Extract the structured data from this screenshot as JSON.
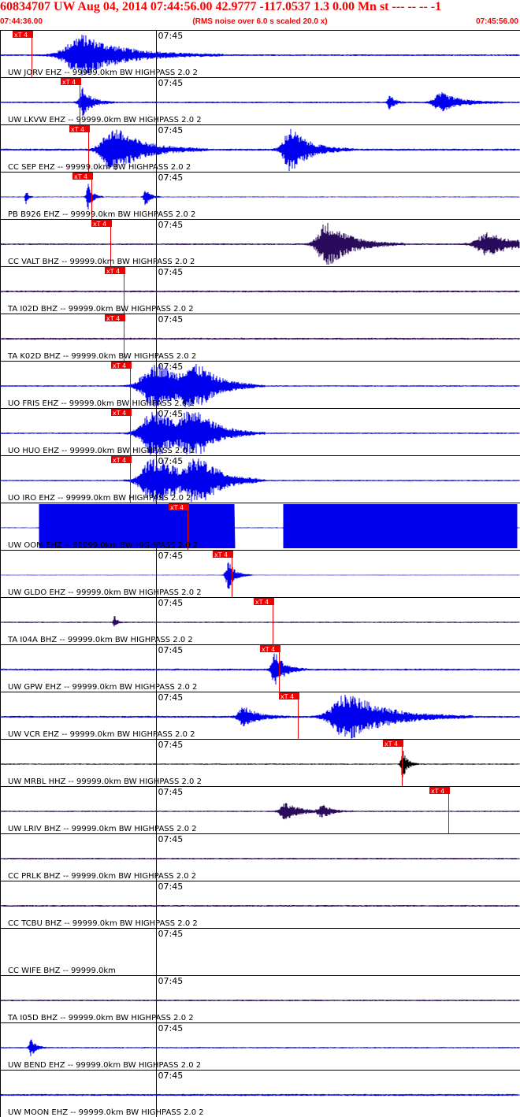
{
  "header": {
    "title": "60834707 UW Aug 04, 2014 07:44:56.00   42.9777 -117.0537  1.3 0.00 Mn st --- -- --  -1",
    "start_time": "07:44:36.00",
    "scale_note": "(RMS noise over 6.0 s scaled 20.0 x)",
    "end_time": "07:45:56.00"
  },
  "colors": {
    "ehz": "#0000ee",
    "bhz": "#2a0a5a",
    "hhz": "#000000",
    "pick": "#ee0000",
    "label": "#000000"
  },
  "chart_data": {
    "type": "seismogram",
    "time_range": [
      "07:44:36.00",
      "07:45:56.00"
    ],
    "minute_mark": "07:45",
    "pick_label": "xT 4",
    "traces": [
      {
        "label": "UW JORV EHZ -- 99999.0km BW  HIGHPASS  2.0  2",
        "color": "ehz",
        "pick": 0.061,
        "events": [
          {
            "c": 0.16,
            "w": 0.09,
            "a": 2.6
          }
        ],
        "noise": 0.35
      },
      {
        "label": "UW LKVW EHZ -- 99999.0km BW  HIGHPASS  2.0  2",
        "color": "ehz",
        "pick": 0.153,
        "events": [
          {
            "c": 0.16,
            "w": 0.02,
            "a": 1.8
          },
          {
            "c": 0.85,
            "w": 0.04,
            "a": 1.2
          },
          {
            "c": 0.75,
            "w": 0.01,
            "a": 1.0
          }
        ],
        "noise": 0.35
      },
      {
        "label": "CC SEP EHZ -- 99999.0km BW  HIGHPASS  2.0  2",
        "color": "ehz",
        "pick": 0.17,
        "events": [
          {
            "c": 0.22,
            "w": 0.06,
            "a": 3.0
          },
          {
            "c": 0.56,
            "w": 0.04,
            "a": 2.8
          }
        ],
        "noise": 0.45
      },
      {
        "label": "PB B926 EHZ -- 99999.0km BW  HIGHPASS  2.0  2",
        "color": "ehz",
        "pick": 0.176,
        "events": [
          {
            "c": 0.17,
            "w": 0.01,
            "a": 1.6
          },
          {
            "c": 0.28,
            "w": 0.01,
            "a": 1.2
          },
          {
            "c": 0.05,
            "w": 0.005,
            "a": 1.0
          }
        ],
        "noise": 0.2
      },
      {
        "label": "CC VALT BHZ -- 99999.0km BW  HIGHPASS  2.0  2",
        "color": "bhz",
        "pick": 0.212,
        "events": [
          {
            "c": 0.63,
            "w": 0.05,
            "a": 3.0
          },
          {
            "c": 0.94,
            "w": 0.06,
            "a": 1.5
          }
        ],
        "noise": 0.35
      },
      {
        "label": "TA I02D BHZ -- 99999.0km BW  HIGHPASS  2.0  2",
        "color": "bhz",
        "pick": 0.238,
        "events": [],
        "noise": 0.4
      },
      {
        "label": "TA K02D BHZ -- 99999.0km BW  HIGHPASS  2.0  2",
        "color": "bhz",
        "pick": 0.238,
        "events": [],
        "noise": 0.4
      },
      {
        "label": "UO FRIS EHZ -- 99999.0km BW  HIGHPASS  2.0  2",
        "color": "ehz",
        "pick": 0.25,
        "events": [
          {
            "c": 0.3,
            "w": 0.07,
            "a": 3.2
          },
          {
            "c": 0.37,
            "w": 0.04,
            "a": 3.2
          }
        ],
        "noise": 0.3
      },
      {
        "label": "UO HUO EHZ -- 99999.0km BW  HIGHPASS  2.0  2",
        "color": "ehz",
        "pick": 0.25,
        "events": [
          {
            "c": 0.3,
            "w": 0.07,
            "a": 3.2
          },
          {
            "c": 0.37,
            "w": 0.04,
            "a": 3.2
          }
        ],
        "noise": 0.3
      },
      {
        "label": "UO IRO EHZ -- 99999.0km BW  HIGHPASS  2.0  2",
        "color": "ehz",
        "pick": 0.25,
        "events": [
          {
            "c": 0.3,
            "w": 0.07,
            "a": 3.2
          },
          {
            "c": 0.38,
            "w": 0.04,
            "a": 3.2
          }
        ],
        "noise": 0.3
      },
      {
        "label": "UW OOM EHZ -- 99999.0km BW  HIGHPASS  2.0  2",
        "color": "ehz",
        "pick": 0.36,
        "saturated": [
          [
            0.075,
            0.45
          ],
          [
            0.545,
            0.995
          ]
        ],
        "events": [],
        "noise": 0.2
      },
      {
        "label": "UW GLDO EHZ -- 99999.0km BW  HIGHPASS  2.0  2",
        "color": "ehz",
        "pick": 0.446,
        "events": [
          {
            "c": 0.44,
            "w": 0.015,
            "a": 1.8
          }
        ],
        "noise": 0.15
      },
      {
        "label": "TA I04A BHZ -- 99999.0km BW  HIGHPASS  2.0  2",
        "color": "bhz",
        "pick": 0.524,
        "events": [
          {
            "c": 0.22,
            "w": 0.005,
            "a": 1.0
          }
        ],
        "noise": 0.3
      },
      {
        "label": "UW GPW EHZ -- 99999.0km BW  HIGHPASS  2.0  2",
        "color": "ehz",
        "pick": 0.537,
        "events": [
          {
            "c": 0.53,
            "w": 0.02,
            "a": 2.2
          }
        ],
        "noise": 0.4
      },
      {
        "label": "UW VCR EHZ -- 99999.0km BW  HIGHPASS  2.0  2",
        "color": "ehz",
        "pick": 0.573,
        "events": [
          {
            "c": 0.47,
            "w": 0.03,
            "a": 1.3
          },
          {
            "c": 0.67,
            "w": 0.08,
            "a": 3.2
          }
        ],
        "noise": 0.4
      },
      {
        "label": "UW MRBL HHZ -- 99999.0km BW  HIGHPASS  2.0  2",
        "color": "hhz",
        "pick": 0.773,
        "events": [
          {
            "c": 0.775,
            "w": 0.01,
            "a": 1.8
          }
        ],
        "noise": 0.25
      },
      {
        "label": "UW LRIV BHZ -- 99999.0km BW  HIGHPASS  2.0  2",
        "color": "bhz",
        "pick": 0.862,
        "events": [
          {
            "c": 0.55,
            "w": 0.03,
            "a": 1.1
          },
          {
            "c": 0.62,
            "w": 0.02,
            "a": 0.8
          }
        ],
        "noise": 0.3
      },
      {
        "label": "CC PRLK BHZ -- 99999.0km BW  HIGHPASS  2.0  2",
        "color": "bhz",
        "pick": null,
        "events": [],
        "noise": 0.35
      },
      {
        "label": "CC TCBU BHZ -- 99999.0km BW  HIGHPASS  2.0  2",
        "color": "bhz",
        "pick": null,
        "events": [],
        "noise": 0.35
      },
      {
        "label": "CC WIFE BHZ -- 99999.0km",
        "color": "bhz",
        "pick": null,
        "flat": true,
        "events": [],
        "noise": 0.0
      },
      {
        "label": "TA I05D BHZ -- 99999.0km BW  HIGHPASS  2.0  2",
        "color": "bhz",
        "pick": null,
        "events": [],
        "noise": 0.35
      },
      {
        "label": "UW BEND EHZ -- 99999.0km BW  HIGHPASS  2.0  2",
        "color": "ehz",
        "pick": null,
        "events": [
          {
            "c": 0.06,
            "w": 0.01,
            "a": 1.2
          }
        ],
        "noise": 0.3
      },
      {
        "label": "UW MOON EHZ -- 99999.0km BW  HIGHPASS  2.0  2",
        "color": "ehz",
        "pick": null,
        "events": [],
        "noise": 0.4
      }
    ]
  }
}
